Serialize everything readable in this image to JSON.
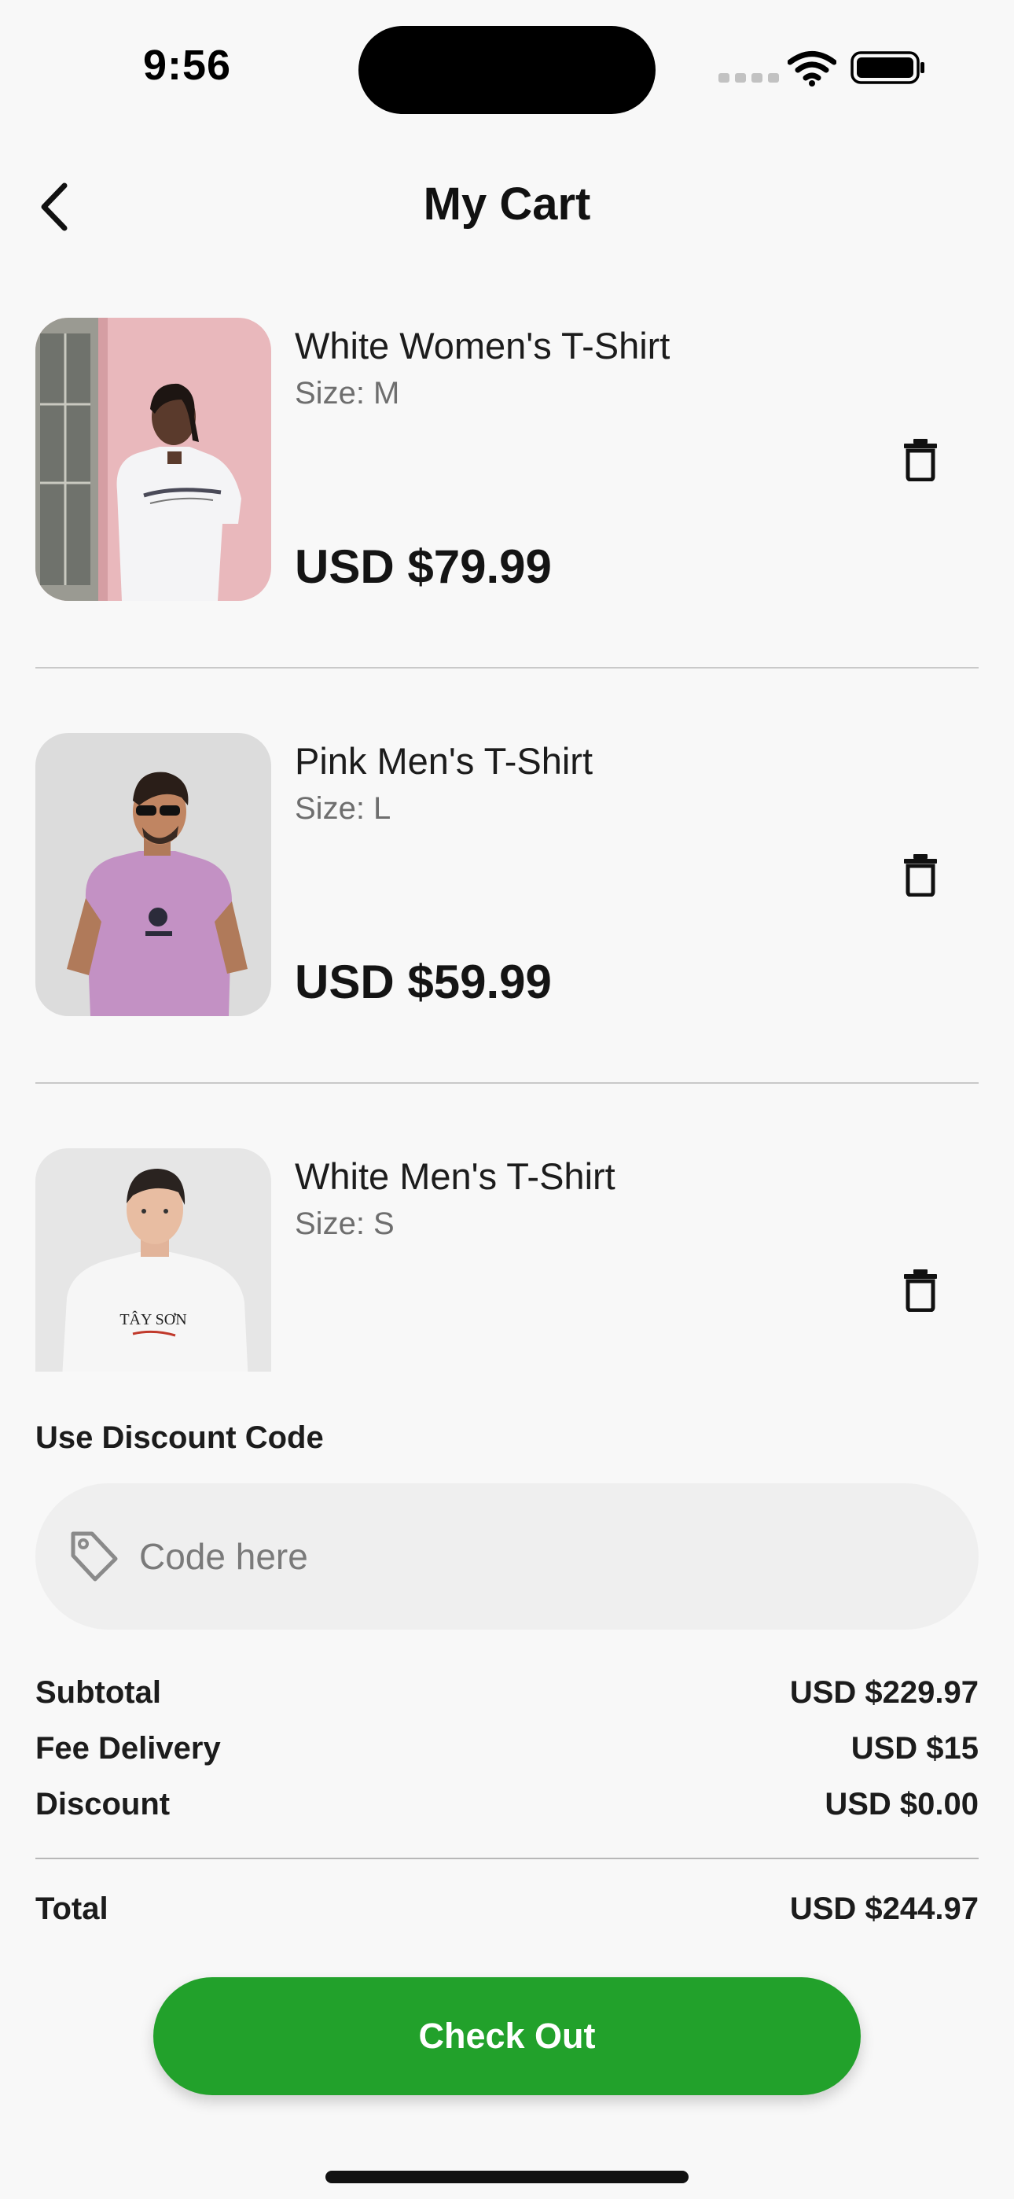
{
  "status_bar": {
    "time": "9:56"
  },
  "header": {
    "title": "My Cart",
    "back_icon": "chevron-left-icon"
  },
  "cart": {
    "items": [
      {
        "name": "White Women's T-Shirt",
        "size": "Size: M",
        "price": "USD $79.99",
        "image": "woman-white-tshirt-photo"
      },
      {
        "name": "Pink Men's T-Shirt",
        "size": "Size: L",
        "price": "USD $59.99",
        "image": "man-pink-tshirt-photo"
      },
      {
        "name": "White Men's T-Shirt",
        "size": "Size: S",
        "price": "",
        "image": "man-white-tshirt-photo"
      }
    ],
    "delete_icon": "trash-icon"
  },
  "discount": {
    "label": "Use Discount Code",
    "placeholder": "Code here",
    "value": "",
    "icon": "tag-icon"
  },
  "summary": {
    "subtotal_label": "Subtotal",
    "subtotal_value": "USD $229.97",
    "delivery_label": "Fee Delivery",
    "delivery_value": "USD $15",
    "discount_label": "Discount",
    "discount_value": "USD $0.00",
    "total_label": "Total",
    "total_value": "USD $244.97"
  },
  "checkout": {
    "label": "Check Out"
  },
  "colors": {
    "accent": "#22a12b",
    "background": "#f8f8f8",
    "field": "#efefef"
  }
}
